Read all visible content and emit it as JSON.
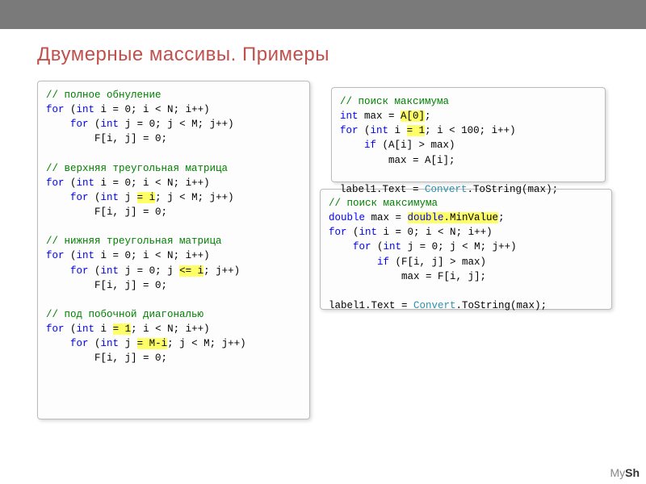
{
  "title": "Двумерные массивы. Примеры",
  "watermark_pre": "My",
  "watermark_bold": "Sh",
  "box1": {
    "c1": "// полное обнуление",
    "l1a": "for",
    "l1b": "int",
    "l1c": " i = 0; i < N; i++)",
    "l2a": "for",
    "l2b": "int",
    "l2c": " j = 0; j < M; j++)",
    "l3": "        F[i, j] = 0;",
    "c2": "// верхняя треугольная матрица",
    "l4a": "for",
    "l4b": "int",
    "l4c": " i = 0; i < N; i++)",
    "l5a": "for",
    "l5b": "int",
    "l5c": " j ",
    "l5h": "= i",
    "l5d": "; j < M; j++)",
    "l6": "        F[i, j] = 0;",
    "c3": "// нижняя треугольная матрица",
    "l7a": "for",
    "l7b": "int",
    "l7c": " i = 0; i < N; i++)",
    "l8a": "for",
    "l8b": "int",
    "l8c": " j = 0; j ",
    "l8h": "<= i",
    "l8d": "; j++)",
    "l9": "        F[i, j] = 0;",
    "c4": "// под побочной диагональю",
    "l10a": "for",
    "l10b": "int",
    "l10c": " i ",
    "l10h": "= 1",
    "l10d": "; i < N; i++)",
    "l11a": "for",
    "l11b": "int",
    "l11c": " j ",
    "l11h": "= M-i",
    "l11d": "; j < M; j++)",
    "l12": "        F[i, j] = 0;"
  },
  "box2": {
    "c1": "// поиск максимума",
    "l1a": "int",
    "l1b": " max = ",
    "l1h": "A[0]",
    "l1c": ";",
    "l2a": "for",
    "l2b": "int",
    "l2c": " i ",
    "l2h": "= 1",
    "l2d": "; i < 100; i++)",
    "l3a": "if",
    "l3b": " (A[i] > max)",
    "l4": "        max = A[i];",
    "l5a": "label1.Text = ",
    "l5ty": "Convert",
    "l5b": ".ToString(max);"
  },
  "box3": {
    "c1": "// поиск максимума",
    "l1a": "double",
    "l1b": " max = ",
    "l1h1": "double",
    "l1h2": ".MinValue",
    "l1c": ";",
    "l2a": "for",
    "l2b": "int",
    "l2c": " i = 0; i < N; i++)",
    "l3a": "for",
    "l3b": "int",
    "l3c": " j = 0; j < M; j++)",
    "l4a": "if",
    "l4b": " (F[i, j] > max)",
    "l5": "            max = F[i, j];",
    "l6a": "label1.Text = ",
    "l6ty": "Convert",
    "l6b": ".ToString(max);"
  }
}
